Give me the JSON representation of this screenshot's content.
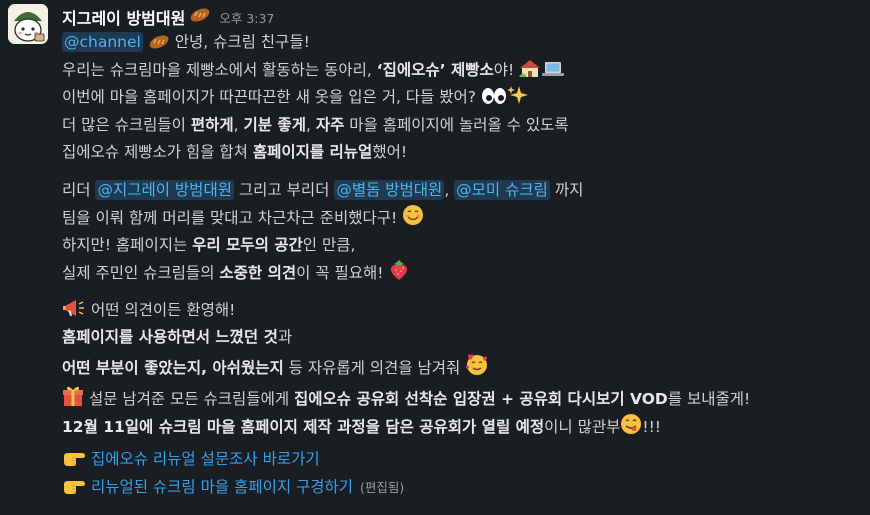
{
  "sender": {
    "name": "지그레이 방범대원",
    "name_emoji": "bread-icon",
    "time": "오후 3:37"
  },
  "message": {
    "p1": {
      "mention_channel": "@channel",
      "greet": "안녕, 슈크림 친구들!",
      "l2a": "우리는 슈크림마을 제빵소에서 활동하는 동아리, ",
      "l2b": "‘집에오슈’ 제빵소",
      "l2c": "야!",
      "l3": "이번에 마을 홈페이지가 따끈따끈한 새 옷을 입은 거, 다들 봤어?",
      "l4a": "더 많은 슈크림들이 ",
      "l4b": "편하게",
      "l4c": ", ",
      "l4d": "기분 좋게",
      "l4e": ", ",
      "l4f": "자주",
      "l4g": " 마을 홈페이지에 놀러올 수 있도록",
      "l5a": "집에오슈 제빵소가 힘을 합쳐 ",
      "l5b": "홈페이지를 리뉴얼",
      "l5c": "했어!"
    },
    "p2": {
      "l1a": "리더 ",
      "mention1": "@지그레이 방범대원",
      "l1b": " 그리고 부리더 ",
      "mention2": "@별돔 방범대원",
      "l1c": ", ",
      "mention3": "@모미 슈크림",
      "l1d": " 까지",
      "l2": "팀을 이뤄 함께 머리를 맞대고 차근차근 준비했다구!",
      "l3a": "하지만! 홈페이지는 ",
      "l3b": "우리 모두의 공간",
      "l3c": "인 만큼,",
      "l4a": "실제 주민인 슈크림들의 ",
      "l4b": "소중한 의견",
      "l4c": "이 꼭 필요해!"
    },
    "p3": {
      "l1": "어떤 의견이든 환영해!",
      "l2a": "홈페이지를 사용하면서 느꼈던 것",
      "l2b": "과",
      "l3a": "어떤 부분이 좋았는지, 아쉬웠는지",
      "l3b": " 등 자유롭게 의견을 남겨줘"
    },
    "p4": {
      "l1a": "설문 남겨준 모든 슈크림들에게 ",
      "l1b": "집에오슈 공유회 선착순 입장권 + 공유회 다시보기 VOD",
      "l1c": "를 보내줄게!",
      "l2a": "12월 11일에 슈크림 마을 홈페이지 제작 과정을 담은 공유회가 열릴 예정",
      "l2b": "이니 많관부",
      "l2c": "!!!"
    },
    "links": {
      "survey": "집에오슈 리뉴얼 설문조사 바로가기",
      "homepage": "리뉴얼된 슈크림 마을 홈페이지 구경하기",
      "edited": "(편집됨)"
    }
  },
  "colors": {
    "background": "#1a1d21",
    "text": "#d1d2d3",
    "mention_bg": "#1d3a52",
    "mention_text": "#4fb3ec",
    "link": "#36a1ea"
  },
  "icons": [
    "bread-icon",
    "house-icon",
    "laptop-icon",
    "eyes-icon",
    "sparkles-icon",
    "smiling-face-icon",
    "strawberry-icon",
    "megaphone-icon",
    "smiling-face-with-hearts-icon",
    "gift-icon",
    "yum-face-icon",
    "pointing-right-icon"
  ]
}
